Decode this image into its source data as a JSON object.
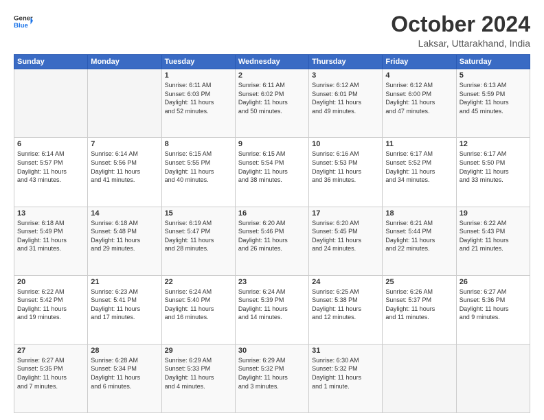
{
  "logo": {
    "line1": "General",
    "line2": "Blue"
  },
  "title": "October 2024",
  "subtitle": "Laksar, Uttarakhand, India",
  "weekdays": [
    "Sunday",
    "Monday",
    "Tuesday",
    "Wednesday",
    "Thursday",
    "Friday",
    "Saturday"
  ],
  "weeks": [
    [
      {
        "day": "",
        "info": ""
      },
      {
        "day": "",
        "info": ""
      },
      {
        "day": "1",
        "info": "Sunrise: 6:11 AM\nSunset: 6:03 PM\nDaylight: 11 hours\nand 52 minutes."
      },
      {
        "day": "2",
        "info": "Sunrise: 6:11 AM\nSunset: 6:02 PM\nDaylight: 11 hours\nand 50 minutes."
      },
      {
        "day": "3",
        "info": "Sunrise: 6:12 AM\nSunset: 6:01 PM\nDaylight: 11 hours\nand 49 minutes."
      },
      {
        "day": "4",
        "info": "Sunrise: 6:12 AM\nSunset: 6:00 PM\nDaylight: 11 hours\nand 47 minutes."
      },
      {
        "day": "5",
        "info": "Sunrise: 6:13 AM\nSunset: 5:59 PM\nDaylight: 11 hours\nand 45 minutes."
      }
    ],
    [
      {
        "day": "6",
        "info": "Sunrise: 6:14 AM\nSunset: 5:57 PM\nDaylight: 11 hours\nand 43 minutes."
      },
      {
        "day": "7",
        "info": "Sunrise: 6:14 AM\nSunset: 5:56 PM\nDaylight: 11 hours\nand 41 minutes."
      },
      {
        "day": "8",
        "info": "Sunrise: 6:15 AM\nSunset: 5:55 PM\nDaylight: 11 hours\nand 40 minutes."
      },
      {
        "day": "9",
        "info": "Sunrise: 6:15 AM\nSunset: 5:54 PM\nDaylight: 11 hours\nand 38 minutes."
      },
      {
        "day": "10",
        "info": "Sunrise: 6:16 AM\nSunset: 5:53 PM\nDaylight: 11 hours\nand 36 minutes."
      },
      {
        "day": "11",
        "info": "Sunrise: 6:17 AM\nSunset: 5:52 PM\nDaylight: 11 hours\nand 34 minutes."
      },
      {
        "day": "12",
        "info": "Sunrise: 6:17 AM\nSunset: 5:50 PM\nDaylight: 11 hours\nand 33 minutes."
      }
    ],
    [
      {
        "day": "13",
        "info": "Sunrise: 6:18 AM\nSunset: 5:49 PM\nDaylight: 11 hours\nand 31 minutes."
      },
      {
        "day": "14",
        "info": "Sunrise: 6:18 AM\nSunset: 5:48 PM\nDaylight: 11 hours\nand 29 minutes."
      },
      {
        "day": "15",
        "info": "Sunrise: 6:19 AM\nSunset: 5:47 PM\nDaylight: 11 hours\nand 28 minutes."
      },
      {
        "day": "16",
        "info": "Sunrise: 6:20 AM\nSunset: 5:46 PM\nDaylight: 11 hours\nand 26 minutes."
      },
      {
        "day": "17",
        "info": "Sunrise: 6:20 AM\nSunset: 5:45 PM\nDaylight: 11 hours\nand 24 minutes."
      },
      {
        "day": "18",
        "info": "Sunrise: 6:21 AM\nSunset: 5:44 PM\nDaylight: 11 hours\nand 22 minutes."
      },
      {
        "day": "19",
        "info": "Sunrise: 6:22 AM\nSunset: 5:43 PM\nDaylight: 11 hours\nand 21 minutes."
      }
    ],
    [
      {
        "day": "20",
        "info": "Sunrise: 6:22 AM\nSunset: 5:42 PM\nDaylight: 11 hours\nand 19 minutes."
      },
      {
        "day": "21",
        "info": "Sunrise: 6:23 AM\nSunset: 5:41 PM\nDaylight: 11 hours\nand 17 minutes."
      },
      {
        "day": "22",
        "info": "Sunrise: 6:24 AM\nSunset: 5:40 PM\nDaylight: 11 hours\nand 16 minutes."
      },
      {
        "day": "23",
        "info": "Sunrise: 6:24 AM\nSunset: 5:39 PM\nDaylight: 11 hours\nand 14 minutes."
      },
      {
        "day": "24",
        "info": "Sunrise: 6:25 AM\nSunset: 5:38 PM\nDaylight: 11 hours\nand 12 minutes."
      },
      {
        "day": "25",
        "info": "Sunrise: 6:26 AM\nSunset: 5:37 PM\nDaylight: 11 hours\nand 11 minutes."
      },
      {
        "day": "26",
        "info": "Sunrise: 6:27 AM\nSunset: 5:36 PM\nDaylight: 11 hours\nand 9 minutes."
      }
    ],
    [
      {
        "day": "27",
        "info": "Sunrise: 6:27 AM\nSunset: 5:35 PM\nDaylight: 11 hours\nand 7 minutes."
      },
      {
        "day": "28",
        "info": "Sunrise: 6:28 AM\nSunset: 5:34 PM\nDaylight: 11 hours\nand 6 minutes."
      },
      {
        "day": "29",
        "info": "Sunrise: 6:29 AM\nSunset: 5:33 PM\nDaylight: 11 hours\nand 4 minutes."
      },
      {
        "day": "30",
        "info": "Sunrise: 6:29 AM\nSunset: 5:32 PM\nDaylight: 11 hours\nand 3 minutes."
      },
      {
        "day": "31",
        "info": "Sunrise: 6:30 AM\nSunset: 5:32 PM\nDaylight: 11 hours\nand 1 minute."
      },
      {
        "day": "",
        "info": ""
      },
      {
        "day": "",
        "info": ""
      }
    ]
  ]
}
